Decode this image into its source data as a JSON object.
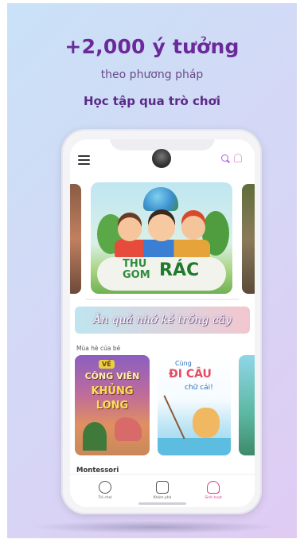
{
  "headline": "+2,000 ý tưởng",
  "subtitle": "theo phương pháp",
  "subtitle_bold": "Học tập qua trò chơi",
  "app": {
    "hero_banner": {
      "title_small_1": "THU",
      "title_small_2": "GOM",
      "title_big": "RÁC"
    },
    "slogan_banner": "Ăn quả nhớ kẻ trồng cây",
    "section_title": "Mùa hè của bé",
    "cards": [
      {
        "tag": "VỀ",
        "line1": "CÔNG VIÊN",
        "line2": "KHỦNG",
        "line3": "LONG"
      },
      {
        "line1": "Cùng",
        "line2": "ĐI CÂU",
        "line3": "chữ cái!"
      }
    ],
    "section_title_2": "Montessori",
    "bottom_nav": [
      {
        "label": "Trò chơi"
      },
      {
        "label": "Khám phá"
      },
      {
        "label": "Sinh hoạt"
      }
    ]
  },
  "colors": {
    "headline": "#6b2a9a",
    "accent": "#b25de0",
    "active_nav": "#d33a8a"
  },
  "icons": [
    "menu-icon",
    "search-icon",
    "bell-icon",
    "game-icon",
    "tv-icon",
    "home-icon"
  ]
}
